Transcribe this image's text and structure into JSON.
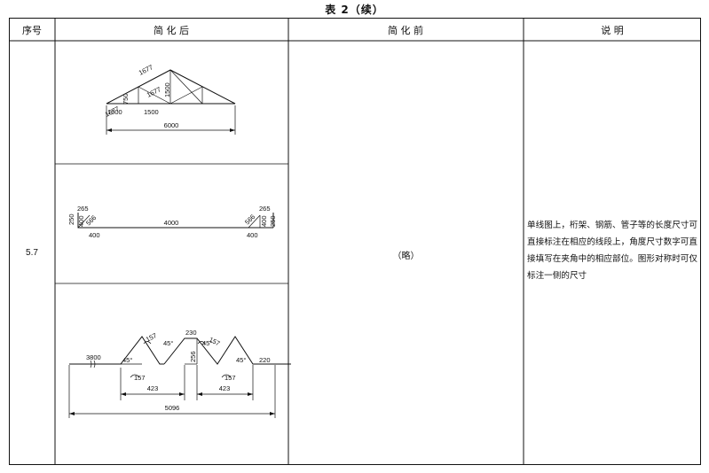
{
  "title": "表 2（续）",
  "headers": {
    "seq": "序号",
    "after": "简 化 后",
    "before": "简 化 前",
    "desc": "说 明"
  },
  "row": {
    "seq": "5.7",
    "before": "（略）",
    "desc": "单线图上，桁架、钢筋、管子等的长度尺寸可直接标注在相应的线段上，角度尺寸数字可直接填写在夹角中的相应部位。图形对称时可仅标注一侧的尺寸"
  },
  "truss": {
    "dims": [
      "1677",
      "1677",
      "1677",
      "750",
      "1500",
      "1500",
      "1500",
      "6000"
    ]
  },
  "channel": {
    "dims": [
      "265",
      "250",
      "400",
      "566",
      "4000",
      "566",
      "265",
      "400",
      "250",
      "400",
      "400"
    ]
  },
  "profile": {
    "dims": [
      "3800",
      "45°",
      "157",
      "157",
      "230",
      "256",
      "45°",
      "45°",
      "157",
      "45°",
      "220",
      "157",
      "423",
      "423",
      "5096"
    ]
  }
}
